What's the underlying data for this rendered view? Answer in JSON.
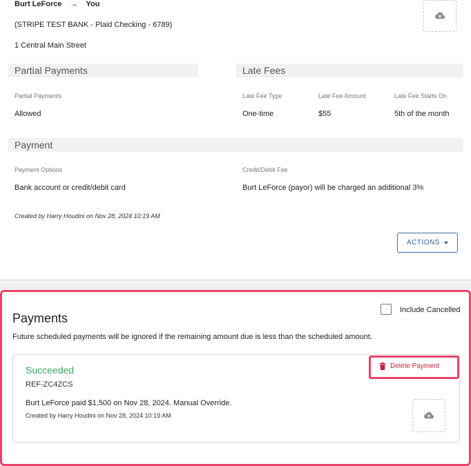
{
  "header": {
    "payer": "Burt LeForce",
    "arrow": "→",
    "payee": "You",
    "bank": "(STRIPE TEST BANK - Plaid Checking - 6789)",
    "address": "1 Central Main Street"
  },
  "partial_payments": {
    "section_title": "Partial Payments",
    "label": "Partial Payments",
    "value": "Allowed"
  },
  "late_fees": {
    "section_title": "Late Fees",
    "type_label": "Late Fee Type",
    "type_value": "One-time",
    "amount_label": "Late Fee Amount",
    "amount_value": "$55",
    "starts_label": "Late Fee Starts On",
    "starts_value": "5th of the month"
  },
  "payment": {
    "section_title": "Payment",
    "options_label": "Payment Options",
    "options_value": "Bank account or credit/debit card",
    "fee_label": "Credit/Debit Fee",
    "fee_value": "Burt LeForce (payor) will be charged an additional 3%"
  },
  "created_by": "Created by Harry Houdini on Nov 28, 2024 10:19 AM",
  "actions_label": "ACTIONS",
  "payments": {
    "title": "Payments",
    "include_cancelled_label": "Include Cancelled",
    "include_cancelled_checked": false,
    "description": "Future scheduled payments will be ignored if the remaining amount due is less than the scheduled amount.",
    "items": [
      {
        "status": "Succeeded",
        "reference": "REF-ZC4ZCS",
        "summary": "Burt LeForce paid $1,500 on Nov 28, 2024. Manual Override.",
        "created_by": "Created by Harry Houdini on Nov 28, 2024 10:19 AM",
        "delete_label": "Delete Payment"
      }
    ]
  },
  "icons": {
    "upload": "cloud-upload-icon",
    "delete": "trash-icon",
    "actions_caret": "caret-down-icon"
  },
  "colors": {
    "success": "#3aa763",
    "danger": "#c8203f",
    "highlight": "#e9436a",
    "primary": "#2d5f95"
  }
}
